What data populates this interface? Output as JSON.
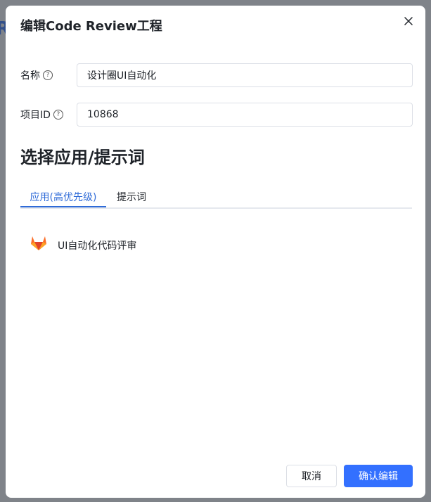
{
  "backdrop": {
    "text": "Re"
  },
  "dialog": {
    "title": "编辑Code Review工程",
    "fields": {
      "name": {
        "label": "名称",
        "value": "设计圈UI自动化"
      },
      "project_id": {
        "label": "项目ID",
        "value": "10868"
      }
    },
    "section_title": "选择应用/提示词",
    "tabs": [
      {
        "label": "应用(高优先级)",
        "active": true
      },
      {
        "label": "提示词",
        "active": false
      }
    ],
    "apps": [
      {
        "label": "UI自动化代码评审",
        "icon": "gitlab-icon"
      }
    ],
    "buttons": {
      "cancel": "取消",
      "confirm": "确认编辑"
    }
  },
  "colors": {
    "primary": "#3370ff",
    "tab_active": "#2f6bd8",
    "gitlab_orange": "#fc6d26"
  }
}
